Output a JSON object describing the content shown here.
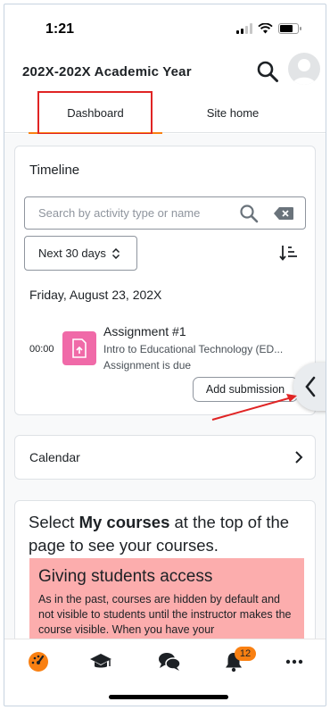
{
  "status_bar": {
    "time": "1:21"
  },
  "header": {
    "title": "202X-202X Academic Year"
  },
  "tabs": [
    {
      "label": "Dashboard",
      "active": true
    },
    {
      "label": "Site home",
      "active": false
    }
  ],
  "timeline": {
    "title": "Timeline",
    "search_placeholder": "Search by activity type or name",
    "filter_label": "Next 30 days",
    "date_heading": "Friday, August 23, 202X",
    "event": {
      "time": "00:00",
      "name": "Assignment #1",
      "course": "Intro to Educational Technology (ED...",
      "status": "Assignment is due",
      "action_label": "Add submission"
    }
  },
  "calendar": {
    "label": "Calendar"
  },
  "info": {
    "line_pre": "Select ",
    "line_bold": "My courses",
    "line_post": " at the top of the page to see your courses.",
    "access_heading": "Giving students access",
    "access_text": "As in the past, courses are hidden by default and not visible to students until the instructor makes the course visible. When you have your"
  },
  "bottom_nav": {
    "items": [
      "dashboard",
      "my-courses",
      "messages",
      "notifications",
      "more"
    ],
    "notification_count": "12"
  },
  "colors": {
    "accent": "#f98012",
    "assignment_icon": "#f06aa8",
    "annotation_red": "#e02424",
    "notice_bg": "#fcadad"
  }
}
